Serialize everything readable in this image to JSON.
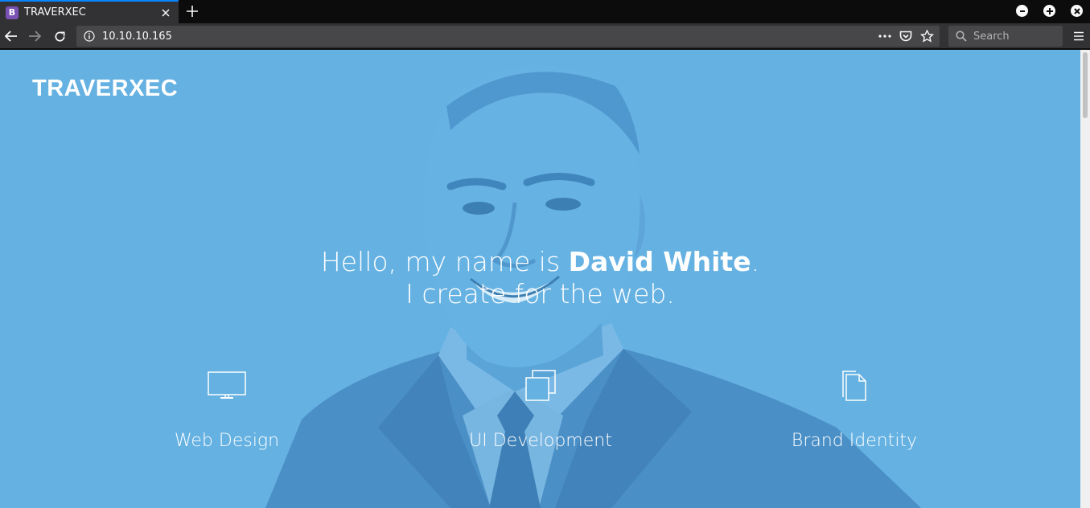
{
  "browser": {
    "tab": {
      "favicon_letter": "B",
      "title": "TRAVERXEC"
    },
    "address": "10.10.10.165",
    "search_placeholder": "Search"
  },
  "page": {
    "brand": "TRAVERXEC",
    "headline": {
      "line1_prefix": "Hello, my name is ",
      "name": "David White",
      "line1_suffix": ".",
      "line2": "I create for the web."
    },
    "services": [
      {
        "label": "Web Design",
        "icon": "monitor-icon"
      },
      {
        "label": "UI Development",
        "icon": "windows-icon"
      },
      {
        "label": "Brand Identity",
        "icon": "document-icon"
      }
    ],
    "colors": {
      "hero_tint": "#64b1e2",
      "chrome": "#323234",
      "tab_accent": "#0a84ff"
    }
  }
}
